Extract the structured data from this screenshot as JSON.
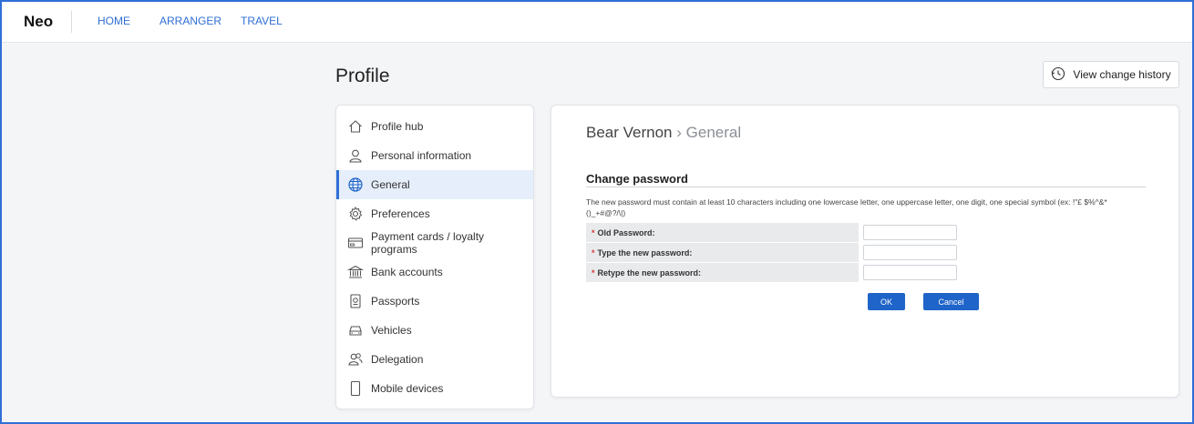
{
  "topbar": {
    "brand": "Neo",
    "nav": [
      "HOME",
      "ARRANGER",
      "TRAVEL"
    ]
  },
  "page": {
    "title": "Profile",
    "history_button": "View change history"
  },
  "sidebar": {
    "items": [
      {
        "label": "Profile hub",
        "icon": "home-icon"
      },
      {
        "label": "Personal information",
        "icon": "user-icon"
      },
      {
        "label": "General",
        "icon": "globe-icon",
        "active": true
      },
      {
        "label": "Preferences",
        "icon": "gear-icon"
      },
      {
        "label": "Payment cards / loyalty programs",
        "icon": "card-icon"
      },
      {
        "label": "Bank accounts",
        "icon": "bank-icon"
      },
      {
        "label": "Passports",
        "icon": "passport-icon"
      },
      {
        "label": "Vehicles",
        "icon": "car-icon"
      },
      {
        "label": "Delegation",
        "icon": "users-icon"
      },
      {
        "label": "Mobile devices",
        "icon": "phone-icon"
      }
    ]
  },
  "main": {
    "crumb_name": "Bear Vernon",
    "crumb_sep": "›",
    "crumb_section": "General",
    "section_title": "Change password",
    "hint": "The new password must contain at least 10 characters including one lowercase letter, one uppercase letter, one digit, one special symbol (ex: !\"£ $%^&*()_+#@?/\\|)",
    "fields": [
      {
        "label": "Old Password:",
        "value": ""
      },
      {
        "label": "Type the new password:",
        "value": ""
      },
      {
        "label": "Retype the new password:",
        "value": ""
      }
    ],
    "required_mark": "*",
    "ok_label": "OK",
    "cancel_label": "Cancel"
  },
  "colors": {
    "accent": "#2f6fd6",
    "button": "#1f64c9",
    "active_bg": "#e6eefb"
  }
}
